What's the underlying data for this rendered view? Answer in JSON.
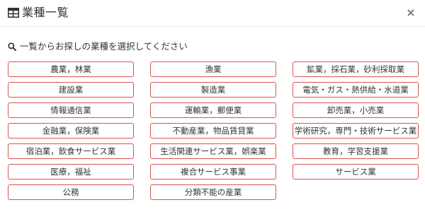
{
  "header": {
    "title": "業種一覧",
    "close_label": "×",
    "icon": "table-list-icon"
  },
  "prompt": {
    "icon": "search-icon",
    "text": "一覧からお探しの業種を選択してください"
  },
  "categories": [
    "農業，林業",
    "漁業",
    "鉱業，採石業，砂利採取業",
    "建設業",
    "製造業",
    "電気・ガス・熱供給・水道業",
    "情報通信業",
    "運輸業，郵便業",
    "卸売業，小売業",
    "金融業，保険業",
    "不動産業，物品賃貸業",
    "学術研究，専門・技術サービス業",
    "宿泊業，飲食サービス業",
    "生活関連サービス業，娯楽業",
    "教育，学習支援業",
    "医療，福祉",
    "複合サービス事業",
    "サービス業",
    "公務",
    "分類不能の産業"
  ],
  "colors": {
    "button_border": "#d9534f",
    "text": "#333333"
  }
}
